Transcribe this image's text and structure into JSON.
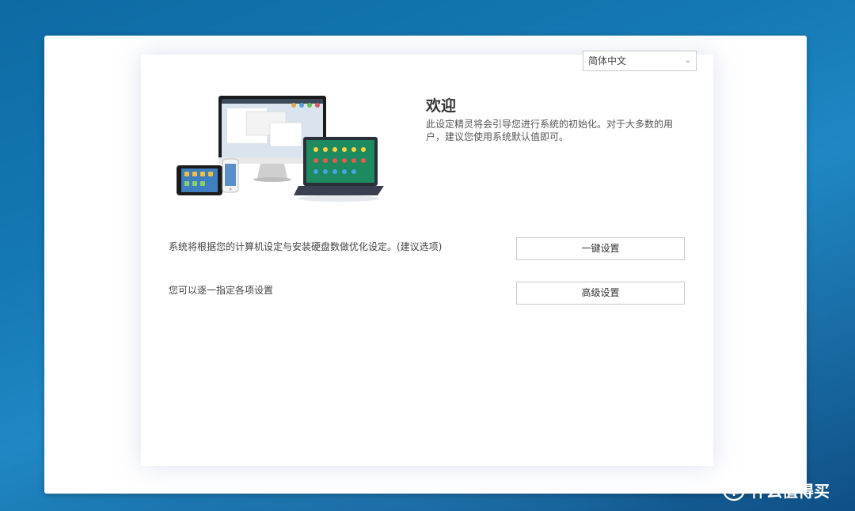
{
  "language_select": {
    "value": "简体中文",
    "chevron_icon": "chevron-down-icon"
  },
  "welcome": {
    "title": "欢迎",
    "description": "此设定精灵将会引导您进行系统的初始化。对于大多数的用户，建议您使用系统默认值即可。"
  },
  "options": [
    {
      "description": "系统将根据您的计算机设定与安装硬盘数做优化设定。(建议选项)",
      "button_label": "一键设置"
    },
    {
      "description": "您可以逐一指定各项设置",
      "button_label": "高级设置"
    }
  ],
  "watermark": {
    "text": "什么值得买"
  },
  "colors": {
    "background": "#1579b5",
    "dialog": "#ffffff",
    "border": "#c9c9c9"
  }
}
